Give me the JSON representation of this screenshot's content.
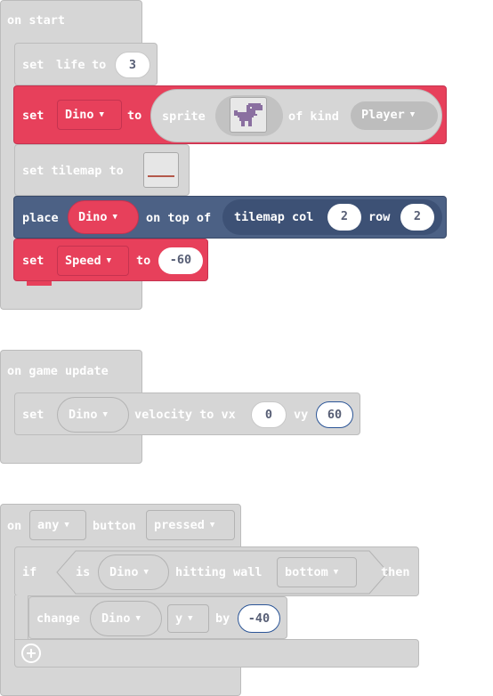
{
  "start": {
    "hat_label": "on start",
    "set_life": {
      "kw": "set",
      "var": "life",
      "to": "to",
      "value": "3"
    },
    "set_dino": {
      "kw": "set",
      "var": "Dino",
      "to": "to",
      "sprite_kw": "sprite",
      "of_kind": "of kind",
      "kind": "Player"
    },
    "set_tilemap": {
      "label": "set tilemap to"
    },
    "place": {
      "kw": "place",
      "var": "Dino",
      "on_top_of": "on top of",
      "tilemap_col": "tilemap col",
      "col": "2",
      "row_kw": "row",
      "row": "2"
    },
    "set_speed": {
      "kw": "set",
      "var": "Speed",
      "to": "to",
      "value": "-60"
    }
  },
  "update": {
    "hat_label": "on game update",
    "velocity": {
      "kw": "set",
      "var": "Dino",
      "velocity_to_vx": "velocity to vx",
      "vx": "0",
      "vy_kw": "vy",
      "vy": "60"
    }
  },
  "button": {
    "on_kw": "on",
    "which": "any",
    "button_kw": "button",
    "event": "pressed",
    "if_block": {
      "if_kw": "if",
      "is_kw": "is",
      "sprite": "Dino",
      "hitting_wall": "hitting wall",
      "side": "bottom",
      "then_kw": "then"
    },
    "change": {
      "kw": "change",
      "sprite": "Dino",
      "prop": "y",
      "by": "by",
      "value": "-40"
    }
  },
  "colors": {
    "grey": "#d6d6d6",
    "red": "#e7405b",
    "blue": "#4c6185"
  },
  "icons": [
    "dropdown-arrow-icon",
    "dino-sprite-icon",
    "tilemap-icon",
    "add-plus-icon"
  ]
}
